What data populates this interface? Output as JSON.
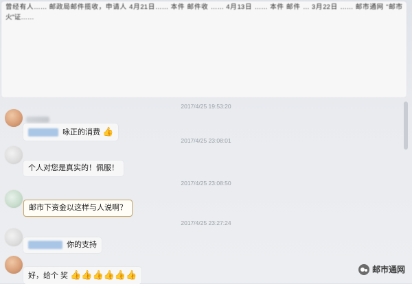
{
  "chat": {
    "long_message": "曾经有人…… 邮政局邮件揽收，申请人 4月21日…… 本件 邮件收 …… 4月13日 …… 本件 邮件 … 3月22日 …… 邮市通网 “邮市火”证……",
    "time_1": "2017/4/25 19:53:20",
    "msg_1_suffix": "咏正的消费",
    "time_2": "2017/4/25 23:08:01",
    "msg_2": "个人对您是真实的！佩服！",
    "time_3": "2017/4/25 23:08:50",
    "msg_3": "邮市下资金以这样与人说啊？",
    "time_4": "2017/4/25 23:27:24",
    "msg_4_suffix": "你的支持",
    "msg_5_prefix": "好，给个 奖",
    "thumbs": "👍",
    "thumbs_row": "👍👍👍👍👍👍",
    "watermark": "邮市通网"
  },
  "colors": {
    "bubble": "#f7f7f7",
    "mask": "#a9c6e6",
    "thumb": "#d89b2f",
    "accent_outline": "#c9a86a"
  },
  "icons": [
    "avatar",
    "thumbs-up-icon",
    "watermark-icon"
  ]
}
